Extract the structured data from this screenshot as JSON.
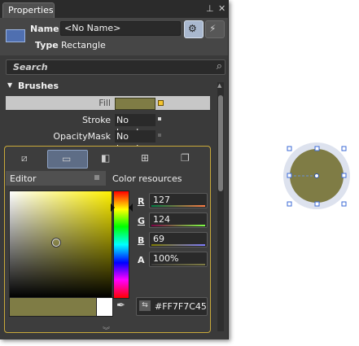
{
  "window": {
    "title": "Properties"
  },
  "header": {
    "name_label": "Name",
    "name_value": "<No Name>",
    "type_label": "Type",
    "type_value": "Rectangle"
  },
  "search": {
    "placeholder": "Search"
  },
  "brushes": {
    "section_title": "Brushes",
    "rows": [
      {
        "label": "Fill",
        "value": ""
      },
      {
        "label": "Stroke",
        "value": "No brush"
      },
      {
        "label": "OpacityMask",
        "value": "No brush"
      }
    ]
  },
  "editor": {
    "tabs": [
      "no-brush",
      "solid-color-brush",
      "gradient-brush",
      "tile-brush",
      "brush-resources"
    ],
    "subtabs": {
      "editor": "Editor",
      "color_resources": "Color resources"
    },
    "channels": [
      {
        "label": "R",
        "value": "127"
      },
      {
        "label": "G",
        "value": "124"
      },
      {
        "label": "B",
        "value": "69"
      },
      {
        "label": "A",
        "value": "100%"
      }
    ],
    "hex": "#FF7F7C45"
  },
  "colors": {
    "fill": "#7f7c45",
    "accent_border": "#c9a93a"
  }
}
